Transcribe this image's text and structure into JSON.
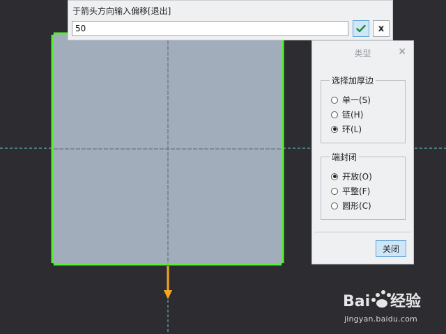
{
  "offset_bar": {
    "prompt": "于箭头方向输入偏移[退出]",
    "value": "50",
    "confirm_icon": "check-icon",
    "cancel_label": "x"
  },
  "dialog": {
    "title": "类型",
    "close_x": "×",
    "thicken_group": {
      "title": "选择加厚边",
      "options": [
        {
          "label": "单一(S)",
          "selected": false
        },
        {
          "label": "链(H)",
          "selected": false
        },
        {
          "label": "环(L)",
          "selected": true
        }
      ]
    },
    "end_cap_group": {
      "title": "端封闭",
      "options": [
        {
          "label": "开放(O)",
          "selected": true
        },
        {
          "label": "平整(F)",
          "selected": false
        },
        {
          "label": "圆形(C)",
          "selected": false
        }
      ]
    },
    "close_button": "关闭"
  },
  "colors": {
    "viewport_bg": "#2c2c31",
    "surface_fill": "#a2adbc",
    "edge_highlight": "#55ee33",
    "arrow": "#f5a623",
    "guide_line": "#5fd4d4",
    "accent_button": "#cfe6f7"
  },
  "watermark": {
    "url": "jingyan.baidu.com"
  }
}
